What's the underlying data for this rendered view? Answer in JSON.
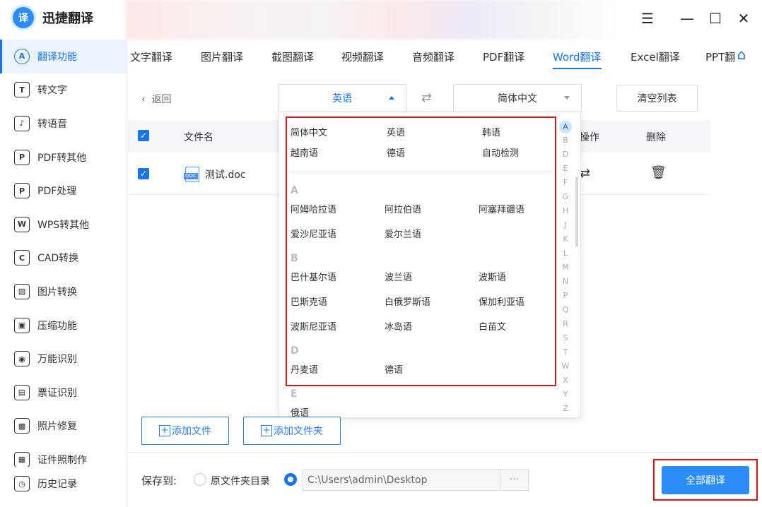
{
  "app": {
    "name": "迅捷翻译",
    "logo_text": "译"
  },
  "window": {
    "menu_icon": "menu-icon",
    "minimize_icon": "minimize-icon",
    "maximize_icon": "maximize-icon",
    "close_icon": "close-icon"
  },
  "sidebar": {
    "items": [
      {
        "label": "翻译功能",
        "icon": "A"
      },
      {
        "label": "转文字",
        "icon": "T"
      },
      {
        "label": "转语音",
        "icon": "♪"
      },
      {
        "label": "PDF转其他",
        "icon": "P"
      },
      {
        "label": "PDF处理",
        "icon": "P"
      },
      {
        "label": "WPS转其他",
        "icon": "W"
      },
      {
        "label": "CAD转换",
        "icon": "C"
      },
      {
        "label": "图片转换",
        "icon": "▨"
      },
      {
        "label": "压缩功能",
        "icon": "▣"
      },
      {
        "label": "万能识别",
        "icon": "◉"
      },
      {
        "label": "票证识别",
        "icon": "▤"
      },
      {
        "label": "照片修复",
        "icon": "▩"
      },
      {
        "label": "证件照制作",
        "icon": "▦"
      }
    ],
    "history": {
      "label": "历史记录",
      "icon": "◷"
    }
  },
  "tabs": [
    "文字翻译",
    "图片翻译",
    "截图翻译",
    "视频翻译",
    "音频翻译",
    "PDF翻译",
    "Word翻译",
    "Excel翻译",
    "PPT翻"
  ],
  "toolbar": {
    "back_label": "返回",
    "source_lang": "英语",
    "target_lang": "简体中文",
    "swap_icon": "⇄",
    "clear_label": "清空列表"
  },
  "table": {
    "headers": {
      "filename": "文件名",
      "action": "操作",
      "delete": "删除"
    },
    "rows": [
      {
        "filename": "测试.doc"
      }
    ]
  },
  "dropdown": {
    "common": [
      "简体中文",
      "英语",
      "韩语",
      "越南语",
      "德语",
      "自动检测"
    ],
    "sections": [
      {
        "letter": "A",
        "items": [
          "阿姆哈拉语",
          "阿拉伯语",
          "阿塞拜疆语",
          "爱沙尼亚语",
          "爱尔兰语"
        ]
      },
      {
        "letter": "B",
        "items": [
          "巴什基尔语",
          "波兰语",
          "波斯语",
          "巴斯克语",
          "白俄罗斯语",
          "保加利亚语",
          "波斯尼亚语",
          "冰岛语",
          "白苗文"
        ]
      },
      {
        "letter": "D",
        "items": [
          "丹麦语",
          "德语"
        ]
      },
      {
        "letter": "E",
        "items": [
          "俄语"
        ]
      }
    ],
    "alphabet": [
      "A",
      "B",
      "D",
      "E",
      "F",
      "G",
      "H",
      "J",
      "K",
      "L",
      "M",
      "N",
      "P",
      "Q",
      "R",
      "S",
      "T",
      "W",
      "X",
      "Y",
      "Z"
    ],
    "active_letter": "A"
  },
  "buttons": {
    "add_file": "添加文件",
    "add_folder": "添加文件夹"
  },
  "footer": {
    "save_to_label": "保存到:",
    "option_original": "原文件夹目录",
    "path_value": "C:\\Users\\admin\\Desktop",
    "browse_label": "···",
    "translate_all": "全部翻译"
  },
  "colors": {
    "accent": "#1a73e8",
    "highlight": "#d9141b"
  }
}
